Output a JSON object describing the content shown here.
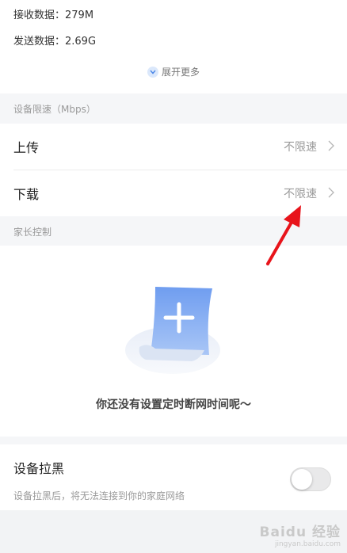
{
  "stats": {
    "received": "接收数据：279M",
    "sent": "发送数据：2.69G"
  },
  "expand_more": "展开更多",
  "speed_limit": {
    "section_title": "设备限速（Mbps）",
    "upload": {
      "label": "上传",
      "value": "不限速"
    },
    "download": {
      "label": "下载",
      "value": "不限速"
    }
  },
  "parental_control": {
    "section_title": "家长控制",
    "empty_message": "你还没有设置定时断网时间呢～"
  },
  "blacklist": {
    "title": "设备拉黑",
    "description": "设备拉黑后，将无法连接到你的家庭网络",
    "enabled": false
  },
  "watermark": {
    "name": "Baidu 经验",
    "url": "jingyan.baidu.com"
  },
  "colors": {
    "accent": "#4a86e8",
    "annotation_arrow": "#e8141b",
    "section_bg": "#f5f6f8"
  },
  "icons": [
    "chevron-down-icon",
    "chevron-right-icon",
    "add-document-illustration",
    "red-arrow-annotation"
  ]
}
